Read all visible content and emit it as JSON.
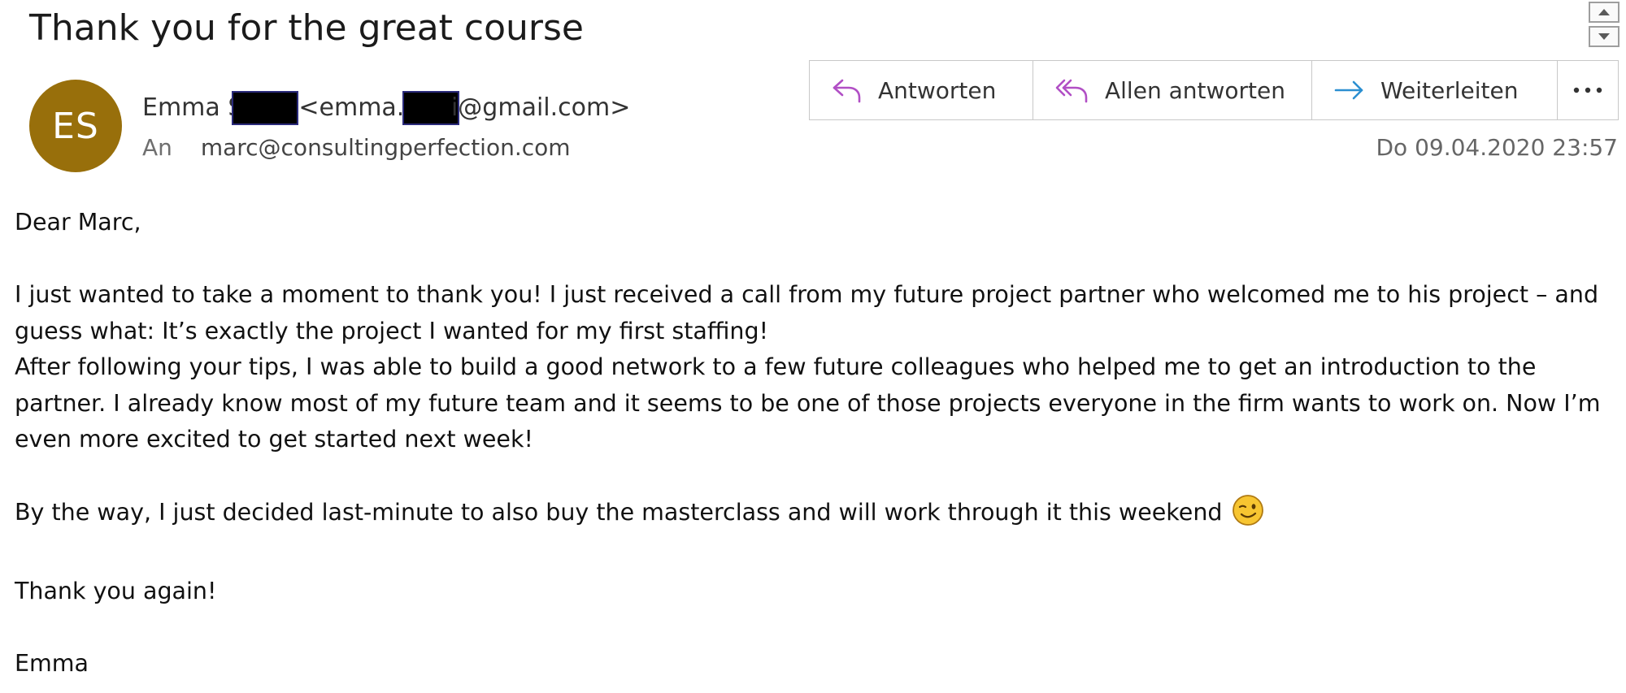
{
  "email": {
    "subject": "Thank you for the great course",
    "avatar_initials": "ES",
    "avatar_color": "#986f0b",
    "sender_name_visible": "Emma S",
    "sender_email_prefix": "<emma.s",
    "sender_email_suffix": "i@gmail.com>",
    "to_label": "An",
    "to_address": "marc@consultingperfection.com",
    "date": "Do 09.04.2020 23:57"
  },
  "actions": {
    "reply_label": "Antworten",
    "reply_all_label": "Allen antworten",
    "forward_label": "Weiterleiten",
    "more_icon": "ellipsis-icon"
  },
  "body": {
    "greeting": "Dear Marc,",
    "para1_line1": "I just wanted to take a moment to thank you! I just received a call from my future project partner who welcomed me to his project – and",
    "para1_line2": "guess what: It’s exactly the project I wanted for my first staffing!",
    "para2_line1": "After following your tips, I was able to build a good network to a few future colleagues who helped me to get an introduction to the",
    "para2_line2": "partner. I already know most of my future team and it seems to be one of those projects everyone in the firm wants to work on. Now I’m",
    "para2_line3": "even more excited to get started next week!",
    "para3": "By the way, I just decided last-minute to also buy the masterclass and will work through it this weekend",
    "closing": "Thank you again!",
    "signature": "Emma"
  },
  "colors": {
    "reply_icon": "#b14fc5",
    "forward_icon": "#2b8fd1"
  }
}
